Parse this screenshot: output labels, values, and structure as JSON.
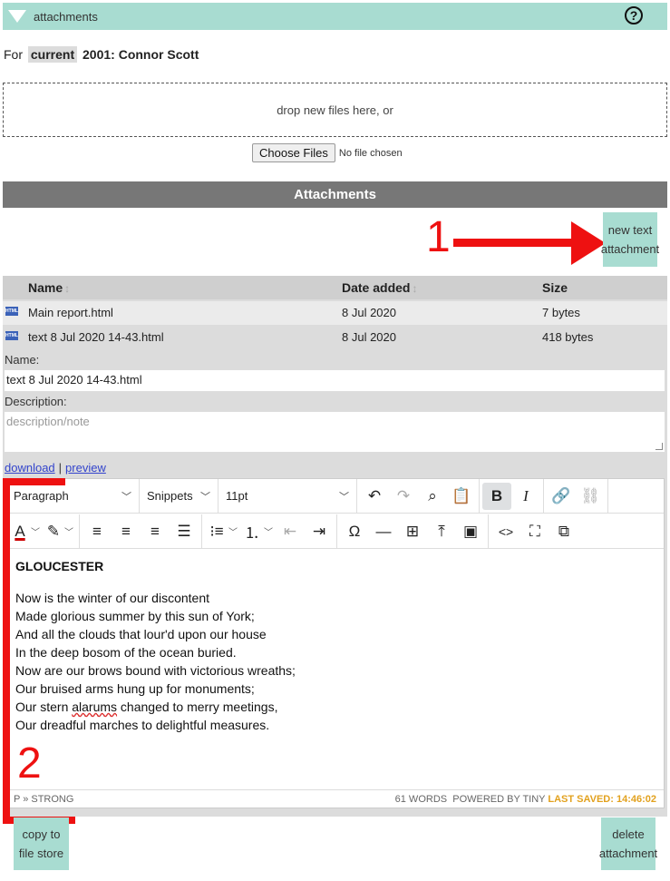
{
  "panel": {
    "title": "attachments",
    "help": "?"
  },
  "for_line": {
    "prefix": "For",
    "badge": "current",
    "record": "2001: Connor Scott"
  },
  "dropzone": {
    "text": "drop new files here, or"
  },
  "file_input": {
    "button": "Choose Files",
    "status": "No file chosen"
  },
  "section_title": "Attachments",
  "new_text_button": {
    "line1": "new text",
    "line2": "attachment"
  },
  "annotations": {
    "one": "1",
    "two": "2",
    "color": "#ee1111"
  },
  "table": {
    "headers": {
      "name": "Name",
      "date": "Date added",
      "size": "Size"
    },
    "rows": [
      {
        "name": "Main report.html",
        "date": "8 Jul 2020",
        "size": "7 bytes"
      },
      {
        "name": "text 8 Jul 2020 14-43.html",
        "date": "8 Jul 2020",
        "size": "418 bytes"
      }
    ]
  },
  "form": {
    "name_label": "Name:",
    "name_value": "text 8 Jul 2020 14-43.html",
    "description_label": "Description:",
    "description_placeholder": "description/note"
  },
  "links": {
    "download": "download",
    "separator": "|",
    "preview": "preview"
  },
  "editor": {
    "format": "Paragraph",
    "snippets": "Snippets",
    "font_size": "11pt",
    "heading": "GLOUCESTER",
    "lines": [
      "Now is the winter of our discontent",
      "Made glorious summer by this sun of York;",
      "And all the clouds that lour'd upon our house",
      "In the deep bosom of the ocean buried.",
      "Now are our brows bound with victorious wreaths;",
      "Our bruised arms hung up for monuments;"
    ],
    "line7_before": "Our stern ",
    "line7_word": "alarums",
    "line7_after": " changed to merry meetings,",
    "line8": "Our dreadful marches to delightful measures.",
    "status_path": "P » STRONG",
    "status_words": "61 WORDS",
    "status_powered": "POWERED BY TINY",
    "status_saved": "LAST SAVED: 14:46:02"
  },
  "copy_button": {
    "line1": "copy to",
    "line2": "file store"
  },
  "delete_button": {
    "line1": "delete",
    "line2": "attachment"
  },
  "colors": {
    "teal": "#a8dcd1",
    "header_gray": "#777777",
    "link": "#3344cc",
    "saved": "#e2a11e"
  }
}
